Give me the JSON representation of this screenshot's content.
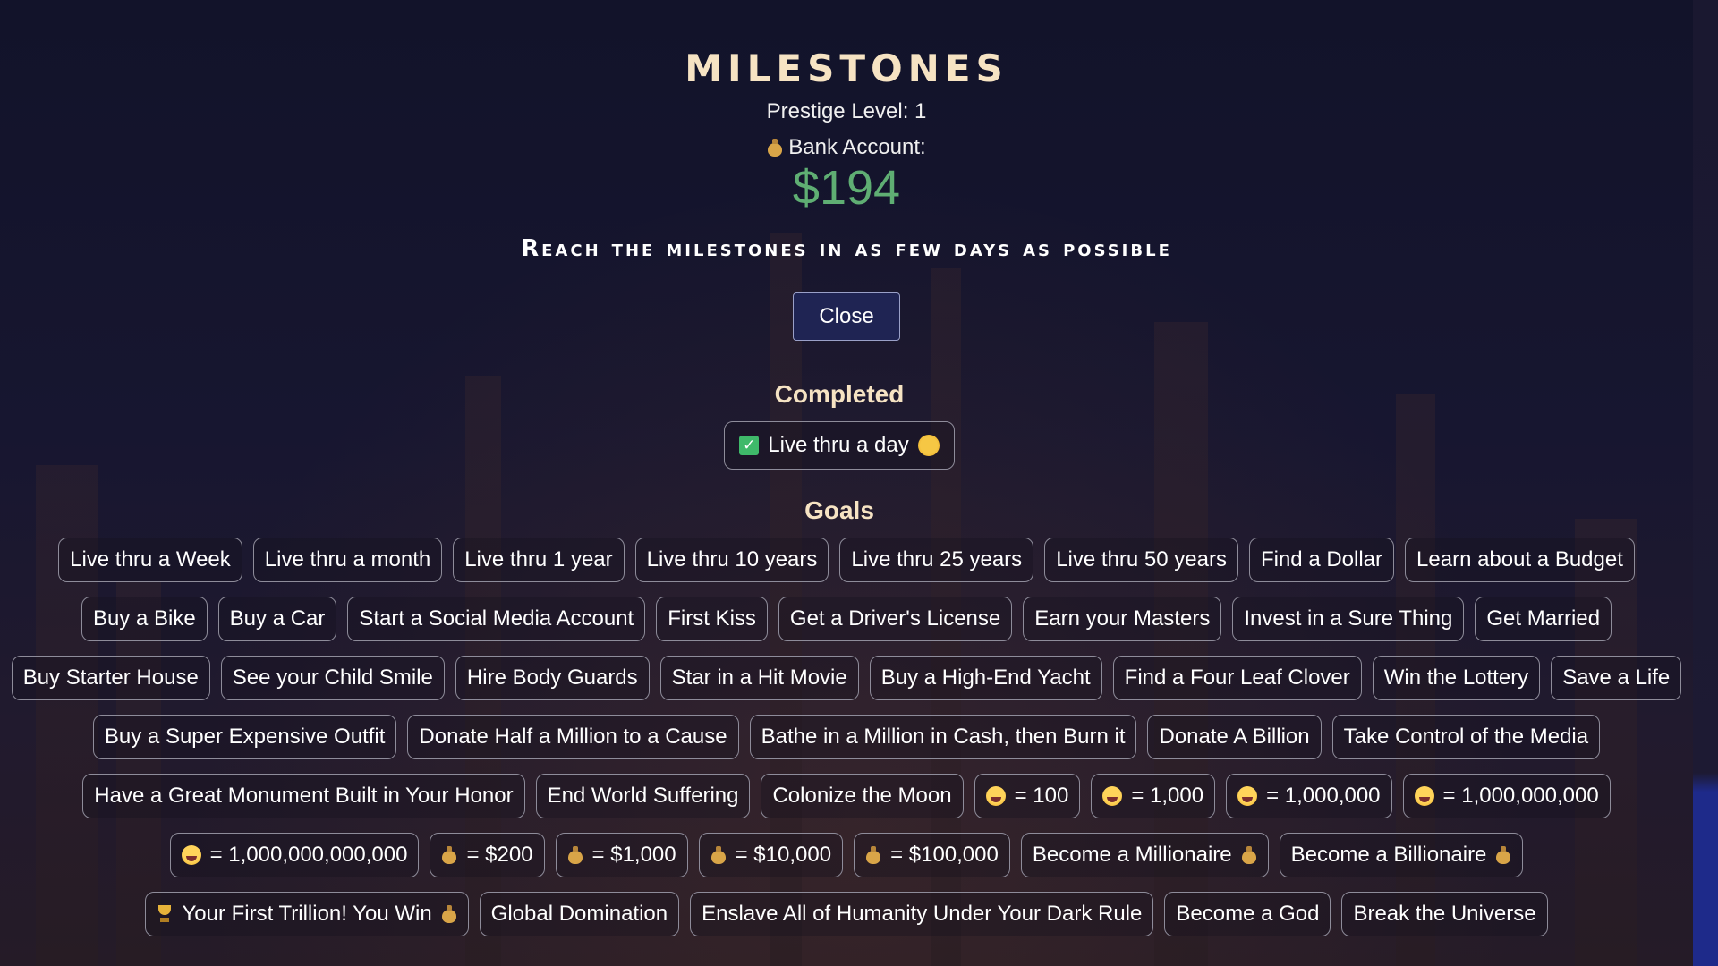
{
  "header": {
    "title": "MILESTONES",
    "prestige": "Prestige Level: 1",
    "bank_label": "Bank Account:",
    "bank_value": "$194",
    "subtitle": "Reach the milestones in as few days as possible",
    "close_label": "Close"
  },
  "completed": {
    "title": "Completed",
    "items": [
      {
        "label": "Live thru a day",
        "icon": "sun-face-icon"
      }
    ]
  },
  "goals": {
    "title": "Goals",
    "rows": [
      [
        {
          "label": "Live thru a Week"
        },
        {
          "label": "Live thru a month"
        },
        {
          "label": "Live thru 1 year"
        },
        {
          "label": "Live thru 10 years"
        },
        {
          "label": "Live thru 25 years"
        },
        {
          "label": "Live thru 50 years"
        },
        {
          "label": "Find a Dollar"
        },
        {
          "label": "Learn about a Budget"
        }
      ],
      [
        {
          "label": "Buy a Bike"
        },
        {
          "label": "Buy a Car"
        },
        {
          "label": "Start a Social Media Account"
        },
        {
          "label": "First Kiss"
        },
        {
          "label": "Get a Driver's License"
        },
        {
          "label": "Earn your Masters"
        },
        {
          "label": "Invest in a Sure Thing"
        },
        {
          "label": "Get Married"
        }
      ],
      [
        {
          "label": "Buy Starter House"
        },
        {
          "label": "See your Child Smile"
        },
        {
          "label": "Hire Body Guards"
        },
        {
          "label": "Star in a Hit Movie"
        },
        {
          "label": "Buy a High-End Yacht"
        },
        {
          "label": "Find a Four Leaf Clover"
        },
        {
          "label": "Win the Lottery"
        },
        {
          "label": "Save a Life"
        }
      ],
      [
        {
          "label": "Buy a Super Expensive Outfit"
        },
        {
          "label": "Donate Half a Million to a Cause"
        },
        {
          "label": "Bathe in a Million in Cash, then Burn it"
        },
        {
          "label": "Donate A Billion"
        },
        {
          "label": "Take Control of the Media"
        }
      ],
      [
        {
          "label": "Have a Great Monument Built in Your Honor"
        },
        {
          "label": "End World Suffering"
        },
        {
          "label": "Colonize the Moon"
        },
        {
          "label": "= 100",
          "prefix_icon": "grin-icon"
        },
        {
          "label": "= 1,000",
          "prefix_icon": "grin-icon"
        },
        {
          "label": "= 1,000,000",
          "prefix_icon": "grin-icon"
        },
        {
          "label": "= 1,000,000,000",
          "prefix_icon": "grin-icon"
        }
      ],
      [
        {
          "label": "= 1,000,000,000,000",
          "prefix_icon": "grin-icon"
        },
        {
          "label": "= $200",
          "prefix_icon": "money-bag-icon"
        },
        {
          "label": "= $1,000",
          "prefix_icon": "money-bag-icon"
        },
        {
          "label": "= $10,000",
          "prefix_icon": "money-bag-icon"
        },
        {
          "label": "= $100,000",
          "prefix_icon": "money-bag-icon"
        },
        {
          "label": "Become a Millionaire",
          "suffix_icon": "money-bag-icon"
        },
        {
          "label": "Become a Billionaire",
          "suffix_icon": "money-bag-icon"
        }
      ],
      [
        {
          "label": "Your First Trillion! You Win",
          "prefix_icon": "trophy-icon",
          "suffix_icon": "money-bag-icon"
        },
        {
          "label": "Global Domination"
        },
        {
          "label": "Enslave All of Humanity Under Your Dark Rule"
        },
        {
          "label": "Become a God"
        },
        {
          "label": "Break the Universe"
        }
      ]
    ]
  },
  "colors": {
    "title": "#f6e3c3",
    "money": "#5fae73",
    "button_bg": "#1f2453",
    "chip_border": "#8e8c9a",
    "check": "#3fb96a"
  }
}
